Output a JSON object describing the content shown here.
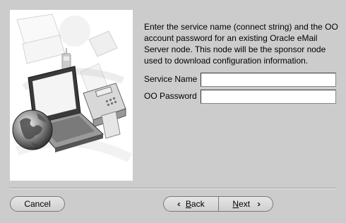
{
  "instructions": "Enter the service name (connect string) and the OO account password for an existing Oracle eMail Server node. This node will be the sponsor node used to download configuration information.",
  "form": {
    "service_name_label": "Service Name",
    "service_name_value": "",
    "password_label": "OO Password",
    "password_value": ""
  },
  "buttons": {
    "cancel_label": "Cancel",
    "back_label": "Back",
    "back_mnemonic": "B",
    "back_rest": "ack",
    "next_label": "Next",
    "next_mnemonic": "N",
    "next_rest": "ext"
  },
  "illustration": {
    "icons": [
      "laptop-icon",
      "globe-icon",
      "mobile-phone-icon",
      "fax-machine-icon",
      "pda-icon",
      "keyboard-icon"
    ]
  },
  "colors": {
    "background": "#cccccc",
    "panel": "#ffffff"
  }
}
